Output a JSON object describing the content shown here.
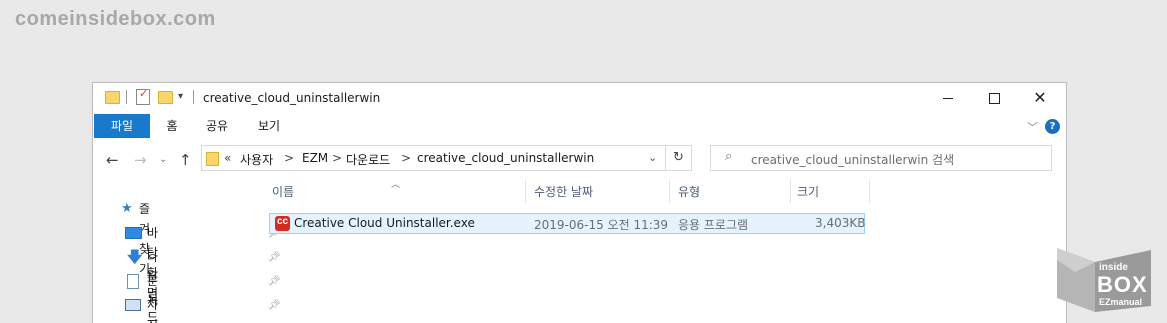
{
  "watermark": "comeinsidebox.com",
  "window": {
    "title": "creative_cloud_uninstallerwin",
    "qa_chevron": "▾"
  },
  "ribbon": {
    "tabs": [
      "파일",
      "홈",
      "공유",
      "보기"
    ],
    "help": "?"
  },
  "address": {
    "overflow": "«",
    "path": [
      "사용자",
      "EZM",
      "다운로드",
      "creative_cloud_uninstallerwin"
    ],
    "separator": ">"
  },
  "search": {
    "placeholder": "creative_cloud_uninstallerwin 검색"
  },
  "nav_pane": {
    "quick_access": "즐겨찾기",
    "items": [
      "바탕 화면",
      "다운로드",
      "문서",
      "사진"
    ]
  },
  "columns": [
    "이름",
    "수정한 날짜",
    "유형",
    "크기"
  ],
  "files": [
    {
      "name": "Creative Cloud Uninstaller.exe",
      "modified": "2019-06-15 오전 11:39",
      "type": "응용 프로그램",
      "size": "3,403KB"
    }
  ],
  "badge": {
    "line1": "inside",
    "line2": "BOX",
    "line3": "EZmanual"
  }
}
